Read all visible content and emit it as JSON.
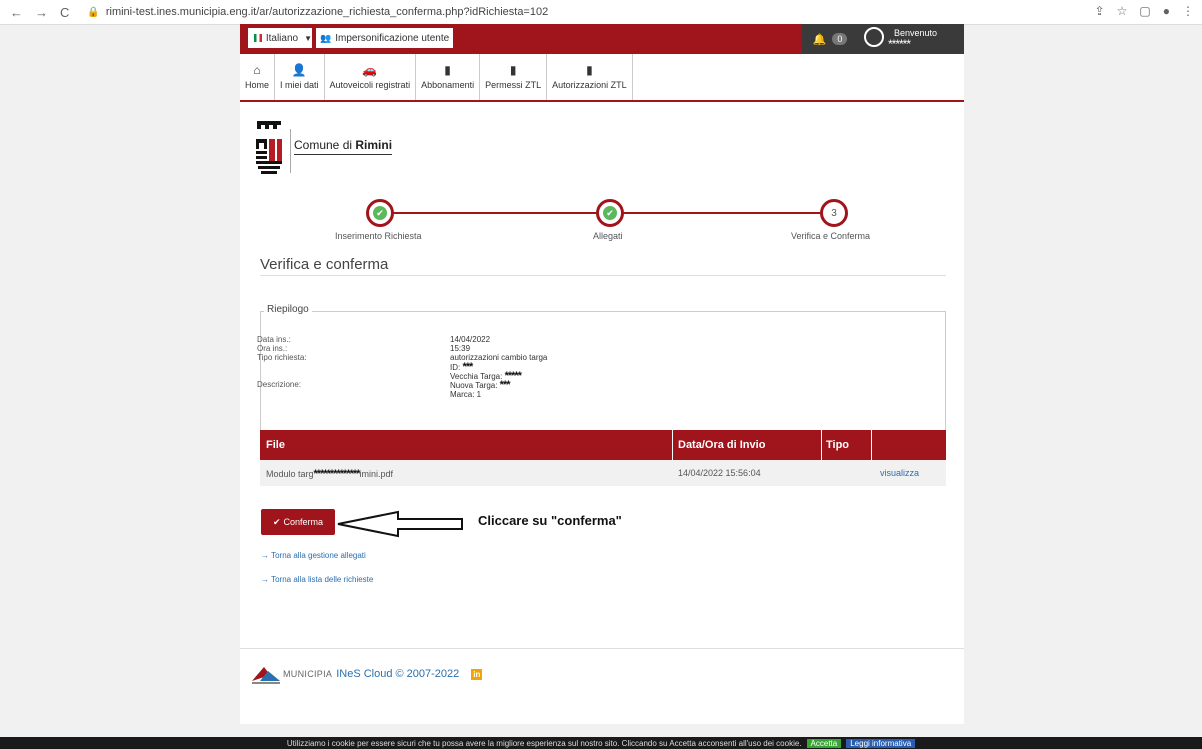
{
  "browser": {
    "url": "rimini-test.ines.municipia.eng.it/ar/autorizzazione_richiesta_conferma.php?idRichiesta=102"
  },
  "topbar": {
    "language": "Italiano",
    "impersonation": "Impersonificazione utente",
    "notifications_count": "0",
    "welcome": "Benvenuto",
    "username": "******"
  },
  "menu": {
    "items": [
      {
        "label": "Home",
        "icon": "home-icon"
      },
      {
        "label": "I miei dati",
        "icon": "user-icon"
      },
      {
        "label": "Autoveicoli registrati",
        "icon": "car-icon"
      },
      {
        "label": "Abbonamenti",
        "icon": "document-icon"
      },
      {
        "label": "Permessi ZTL",
        "icon": "document-icon"
      },
      {
        "label": "Autorizzazioni ZTL",
        "icon": "document-icon"
      }
    ]
  },
  "logo": {
    "prefix": "Comune di ",
    "city": "Rimini"
  },
  "stepper": {
    "steps": [
      {
        "label": "Inserimento Richiesta",
        "state": "done"
      },
      {
        "label": "Allegati",
        "state": "done"
      },
      {
        "label": "Verifica e Conferma",
        "number": "3",
        "state": "current"
      }
    ]
  },
  "section": {
    "title": "Verifica e conferma"
  },
  "summary": {
    "legend": "Riepilogo",
    "data_label": "Data ins.:",
    "data_value": "14/04/2022",
    "ora_label": "Ora ins.:",
    "ora_value": "15:39",
    "tipo_label": "Tipo richiesta:",
    "tipo_value": "autorizzazioni cambio targa",
    "descr_label": "Descrizione:",
    "descr_id_label": "ID: ",
    "descr_id_value": "***",
    "descr_old_label": "Vecchia Targa: ",
    "descr_old_value": "*****",
    "descr_new_label": "Nuova Targa: ",
    "descr_new_value": "***",
    "descr_marca": "Marca: 1"
  },
  "files_table": {
    "headers": [
      "File",
      "Data/Ora di Invio",
      "Tipo",
      ""
    ],
    "rows": [
      {
        "file_prefix": "Modulo targ",
        "file_mask": "**************",
        "file_suffix": "imini.pdf",
        "datetime": "14/04/2022 15:56:04",
        "tipo": "",
        "action": "visualizza"
      }
    ]
  },
  "actions": {
    "confirm": "Conferma",
    "annotation": "Cliccare su \"conferma\"",
    "back_attachments": "Torna alla gestione allegati",
    "back_list": "Torna alla lista delle richieste"
  },
  "footer": {
    "brand": "MUNICIPIA",
    "copyright": "INeS Cloud © 2007-2022",
    "linkedin": "in"
  },
  "cookie": {
    "text": "Utilizziamo i cookie per essere sicuri che tu possa avere la migliore esperienza sul nostro sito. Cliccando su Accetta acconsenti all'uso dei cookie.",
    "accept": "Accetta",
    "info": "Leggi informativa"
  },
  "colors": {
    "brand_red": "#a0141b",
    "success_green": "#5cb85c",
    "link_blue": "#2a6fb0"
  }
}
